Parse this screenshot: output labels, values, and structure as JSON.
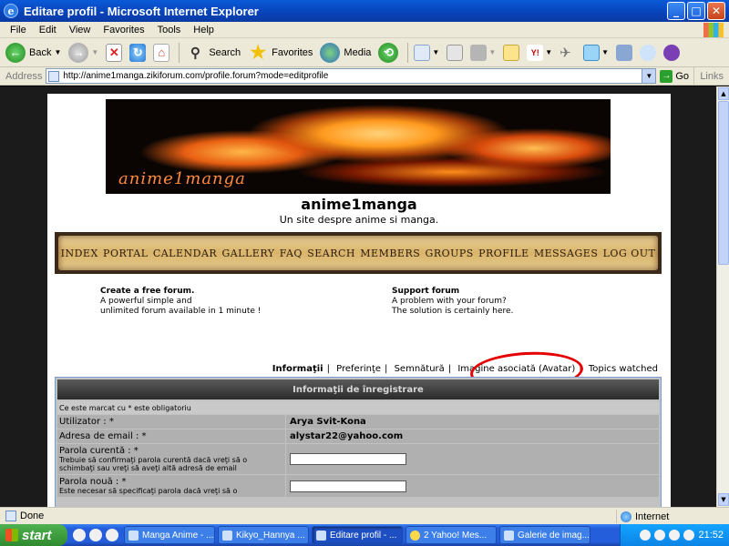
{
  "window": {
    "title": "Editare profil - Microsoft Internet Explorer",
    "minimize": "_",
    "maximize": "□",
    "close": "✕"
  },
  "menu": [
    "File",
    "Edit",
    "View",
    "Favorites",
    "Tools",
    "Help"
  ],
  "toolbar": {
    "back": "Back",
    "search": "Search",
    "favorites": "Favorites",
    "media": "Media"
  },
  "address": {
    "label": "Address",
    "url": "http://anime1manga.zikiforum.com/profile.forum?mode=editprofile",
    "go": "Go",
    "links": "Links"
  },
  "site": {
    "banner_brand": "anime1manga",
    "title": "anime1manga",
    "subtitle": "Un site despre anime si manga.",
    "nav": [
      "INDEX",
      "PORTAL",
      "CALENDAR",
      "GALLERY",
      "FAQ",
      "SEARCH",
      "MEMBERS",
      "GROUPS",
      "PROFILE",
      "MESSAGES",
      "LOG OUT"
    ],
    "promo_left": {
      "title": "Create a free forum.",
      "line1": "A powerful simple and",
      "line2": "unlimited forum available in 1 minute !"
    },
    "promo_right": {
      "title": "Support forum",
      "line1": "A problem with your forum?",
      "line2": "The solution is certainly here."
    },
    "tabs": [
      "Informaţii",
      "Preferinţe",
      "Semnătură",
      "Imagine asociată (Avatar)",
      "Topics watched"
    ],
    "form": {
      "header": "Informaţii de înregistrare",
      "note": "Ce este marcat cu * este obligatoriu",
      "username_label": "Utilizator : *",
      "username_value": "Arya Svit-Kona",
      "email_label": "Adresa de email : *",
      "email_value": "alystar22@yahoo.com",
      "current_pw_label": "Parola curentă : *",
      "current_pw_help": "Trebuie să confirmaţi parola curentă dacă vreţi să o schimbaţi sau vreţi să aveţi altă adresă de email",
      "new_pw_label": "Parola nouă : *",
      "new_pw_help": "Este necesar să specificaţi parola dacă vreţi să o"
    }
  },
  "status": {
    "text": "Done",
    "zone": "Internet"
  },
  "taskbar": {
    "start": "start",
    "tasks": [
      "Manga Anime - ...",
      "Kikyo_Hannya ...",
      "Editare profil - ...",
      "2 Yahoo! Mes...",
      "Galerie de imag..."
    ],
    "active_task": 2,
    "clock": "21:52"
  }
}
